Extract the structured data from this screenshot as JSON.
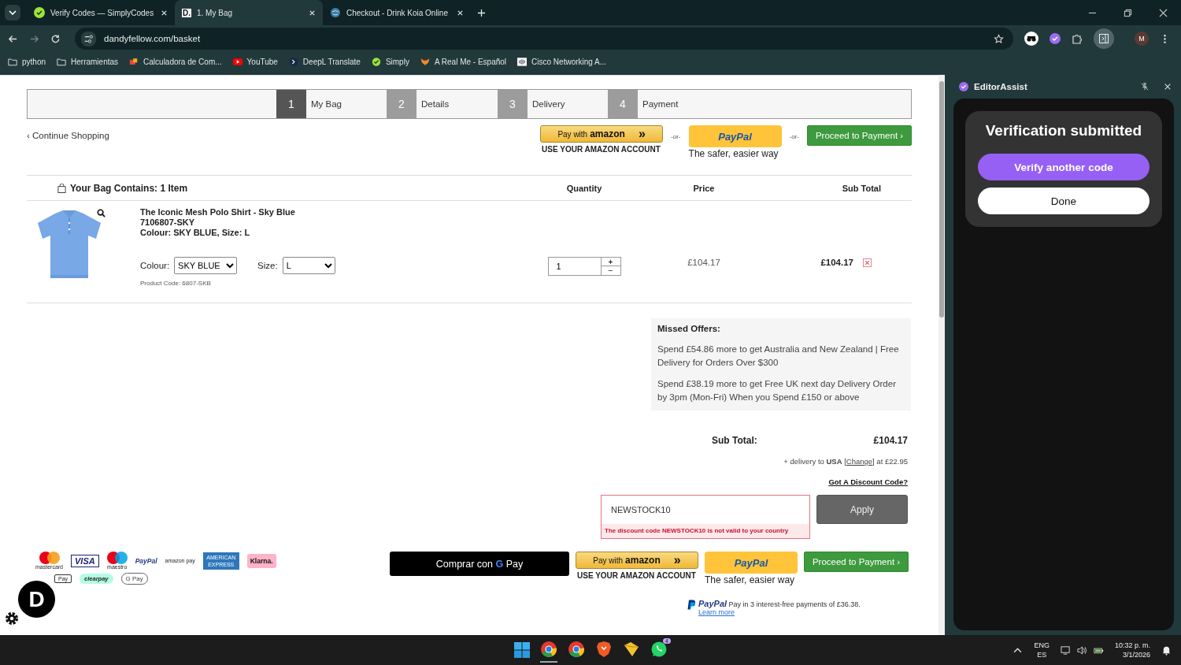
{
  "browser": {
    "tabs": [
      {
        "title": "Verify Codes — SimplyCodes",
        "selected": false
      },
      {
        "title": "1. My Bag",
        "selected": true,
        "favicon_text": "D."
      },
      {
        "title": "Checkout - Drink Koia Online",
        "selected": false
      }
    ],
    "url": "dandyfellow.com/basket",
    "profile_initial": "M",
    "bookmarks": [
      {
        "label": "python"
      },
      {
        "label": "Herramientas"
      },
      {
        "label": "Calculadora de Com..."
      },
      {
        "label": "YouTube"
      },
      {
        "label": "DeepL Translate"
      },
      {
        "label": "Simply"
      },
      {
        "label": "A Real Me - Español"
      },
      {
        "label": "Cisco Networking A..."
      }
    ]
  },
  "steps": [
    {
      "number": "1",
      "label": "My Bag",
      "selected": true
    },
    {
      "number": "2",
      "label": "Details",
      "selected": false
    },
    {
      "number": "3",
      "label": "Delivery",
      "selected": false
    },
    {
      "number": "4",
      "label": "Payment",
      "selected": false
    }
  ],
  "continue_link": "‹ Continue Shopping",
  "checkout_top": {
    "amazon_label": "Pay with",
    "amazon_brand": "amazon",
    "amazon_arrows": "»",
    "amazon_caption": "USE YOUR AMAZON ACCOUNT",
    "paypal": "PayPal",
    "paypal_caption": "The safer, easier way",
    "proceed": "Proceed to Payment ›",
    "separators": [
      "-or-",
      "-or-"
    ]
  },
  "bag": {
    "title": "Your Bag Contains: 1 Item",
    "columns": [
      "Quantity",
      "Price",
      "Sub Total"
    ],
    "items": [
      {
        "name": "The Iconic Mesh Polo Shirt - Sky Blue",
        "sku": "7106807-SKY",
        "variant": "Colour: SKY BLUE, Size: L",
        "colour_label": "Colour:",
        "colour": "SKY BLUE",
        "size_label": "Size:",
        "size": "L",
        "product_code": "Product Code: 6807-SKB",
        "quantity": "1",
        "plus": "+",
        "minus": "−",
        "price": "£104.17",
        "subtotal": "£104.17"
      }
    ]
  },
  "missed_offers": {
    "title": "Missed Offers:",
    "offers": [
      "Spend £54.86 more to get Australia and New Zealand | Free Delivery for Orders Over $300",
      "Spend £38.19 more to get Free UK next day Delivery Order by 3pm (Mon-Fri) When you Spend £150 or above"
    ]
  },
  "totals": {
    "label": "Sub Total:",
    "value": "£104.17",
    "delivery_before": "+ delivery to **USA** [",
    "change_link": "Change",
    "delivery_after": "] at £22.95"
  },
  "discount": {
    "link": "Got A Discount Code?",
    "value": "NEWSTOCK10",
    "invalid": true,
    "error": "The discount code NEWSTOCK10 is not valid to your country",
    "apply": "Apply"
  },
  "payment_logos": [
    {
      "kind": "mastercard",
      "label": "mastercard"
    },
    {
      "kind": "visa",
      "label": "VISA"
    },
    {
      "kind": "maestro",
      "label": "maestro"
    },
    {
      "kind": "paypal",
      "label": "PayPal"
    },
    {
      "kind": "amazonpay",
      "label": "amazon pay"
    },
    {
      "kind": "amex",
      "label": "AMERICAN EXPRESS"
    },
    {
      "kind": "klarna",
      "label": "Klarna."
    },
    {
      "kind": "applepay",
      "label": "Pay"
    },
    {
      "kind": "clearpay",
      "label": "clearpay"
    },
    {
      "kind": "gpay",
      "label": "G Pay"
    }
  ],
  "checkout_bottom": {
    "gpay_label": "Comprar con",
    "gpay_g": "G",
    "gpay_pay": "Pay",
    "amazon_label": "Pay with",
    "amazon_brand": "amazon",
    "amazon_arrows": "»",
    "amazon_caption": "USE YOUR AMAZON ACCOUNT",
    "paypal": "PayPal",
    "paypal_caption": "The safer, easier way",
    "proceed": "Proceed to Payment ›"
  },
  "paypal_later": {
    "brand": "PayPal",
    "text": "Pay in 3 interest-free payments of £36.38.",
    "link": "Learn more"
  },
  "site_badge": "D",
  "side_panel": {
    "title": "EditorAssist",
    "heading": "Verification submitted",
    "primary": "Verify another code",
    "secondary": "Done"
  },
  "taskbar": {
    "apps": [
      {
        "kind": "chrome",
        "selected": true
      },
      {
        "kind": "chrome",
        "selected": false
      },
      {
        "kind": "brave",
        "selected": false
      },
      {
        "kind": "files",
        "selected": false
      },
      {
        "kind": "whatsapp",
        "selected": false,
        "badge": "4"
      }
    ],
    "language": "ENG",
    "layout": "ES",
    "time": "10:32 p. m.",
    "date": "3/1/2026"
  }
}
